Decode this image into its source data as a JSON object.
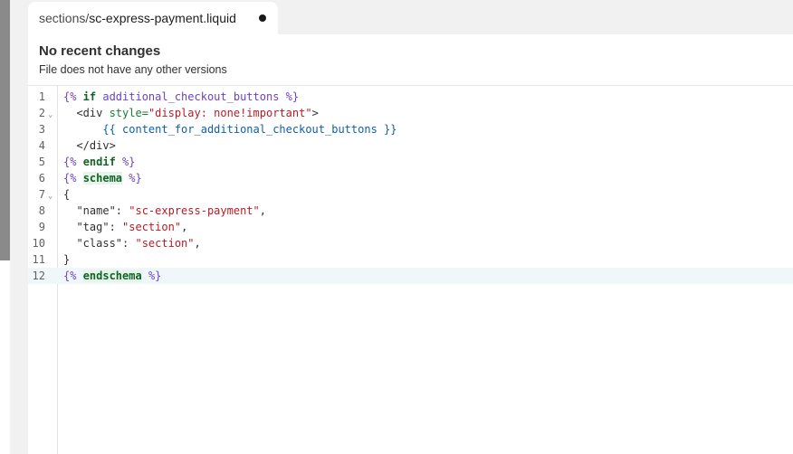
{
  "tab": {
    "dir": "sections/",
    "file": "sc-express-payment.liquid"
  },
  "info": {
    "title": "No recent changes",
    "subtitle": "File does not have any other versions"
  },
  "editor": {
    "line_numbers": [
      "1",
      "2",
      "3",
      "4",
      "5",
      "6",
      "7",
      "8",
      "9",
      "10",
      "11",
      "12"
    ],
    "active_line": 12,
    "lines": {
      "l1": {
        "a": "{%",
        "b": " if ",
        "c": "additional_checkout_buttons",
        "d": " %}"
      },
      "l2": {
        "a": "  <div ",
        "b": "style=",
        "c": "\"display: none!important\"",
        "d": ">"
      },
      "l3": {
        "a": "      {{ ",
        "b": "content_for_additional_checkout_buttons",
        "c": " }}"
      },
      "l4": {
        "a": "  </div>"
      },
      "l5": {
        "a": "{% ",
        "b": "endif",
        "c": " %}"
      },
      "l6": {
        "a": "{% ",
        "b": "schema",
        "c": " %}"
      },
      "l7": {
        "a": "{"
      },
      "l8": {
        "a": "  \"name\": ",
        "b": "\"sc-express-payment\"",
        "c": ","
      },
      "l9": {
        "a": "  \"tag\": ",
        "b": "\"section\"",
        "c": ","
      },
      "l10": {
        "a": "  \"class\": ",
        "b": "\"section\"",
        "c": ","
      },
      "l11": {
        "a": "}"
      },
      "l12": {
        "a": "{% ",
        "b": "endschema",
        "c": " %}"
      }
    }
  }
}
